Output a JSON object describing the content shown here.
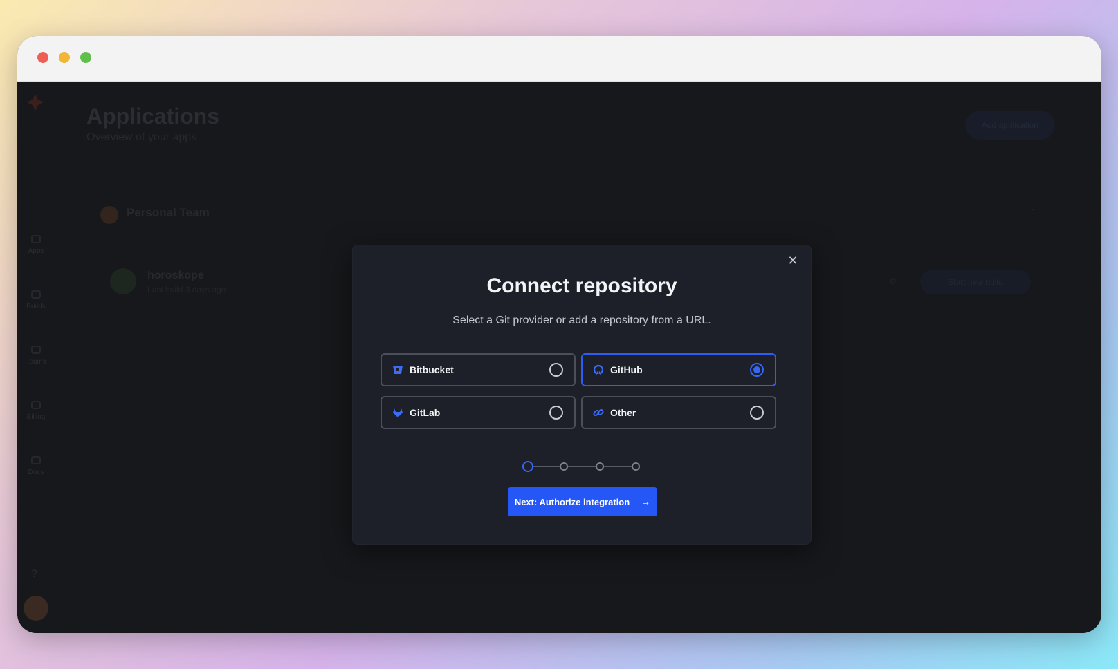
{
  "background_app": {
    "sidebar": {
      "items": [
        {
          "label": "Apps",
          "icon": "folder-icon"
        },
        {
          "label": "Builds",
          "icon": "builds-icon"
        },
        {
          "label": "Teams",
          "icon": "teams-icon"
        },
        {
          "label": "Billing",
          "icon": "billing-icon"
        },
        {
          "label": "Docs",
          "icon": "docs-icon"
        }
      ],
      "help_label": "?"
    },
    "header": {
      "title": "Applications",
      "subtitle": "Overview of your apps",
      "add_button": "Add application"
    },
    "team": {
      "name": "Personal Team",
      "apps": [
        {
          "name": "horoskope",
          "meta": "Last build 3 days ago",
          "action": "Start new build"
        }
      ]
    }
  },
  "modal": {
    "title": "Connect repository",
    "subtitle": "Select a Git provider or add a repository from a URL.",
    "close_label": "✕",
    "providers": [
      {
        "label": "Bitbucket",
        "icon": "bitbucket-icon",
        "selected": false
      },
      {
        "label": "GitHub",
        "icon": "github-icon",
        "selected": true
      },
      {
        "label": "GitLab",
        "icon": "gitlab-icon",
        "selected": false
      },
      {
        "label": "Other",
        "icon": "link-icon",
        "selected": false
      }
    ],
    "stepper": {
      "total_steps": 4,
      "current_step": 1
    },
    "next_button": "Next: Authorize integration",
    "next_arrow": "→"
  },
  "colors": {
    "accent": "#2457f5",
    "modal_bg": "#1d2029",
    "app_bg": "#16181b"
  }
}
